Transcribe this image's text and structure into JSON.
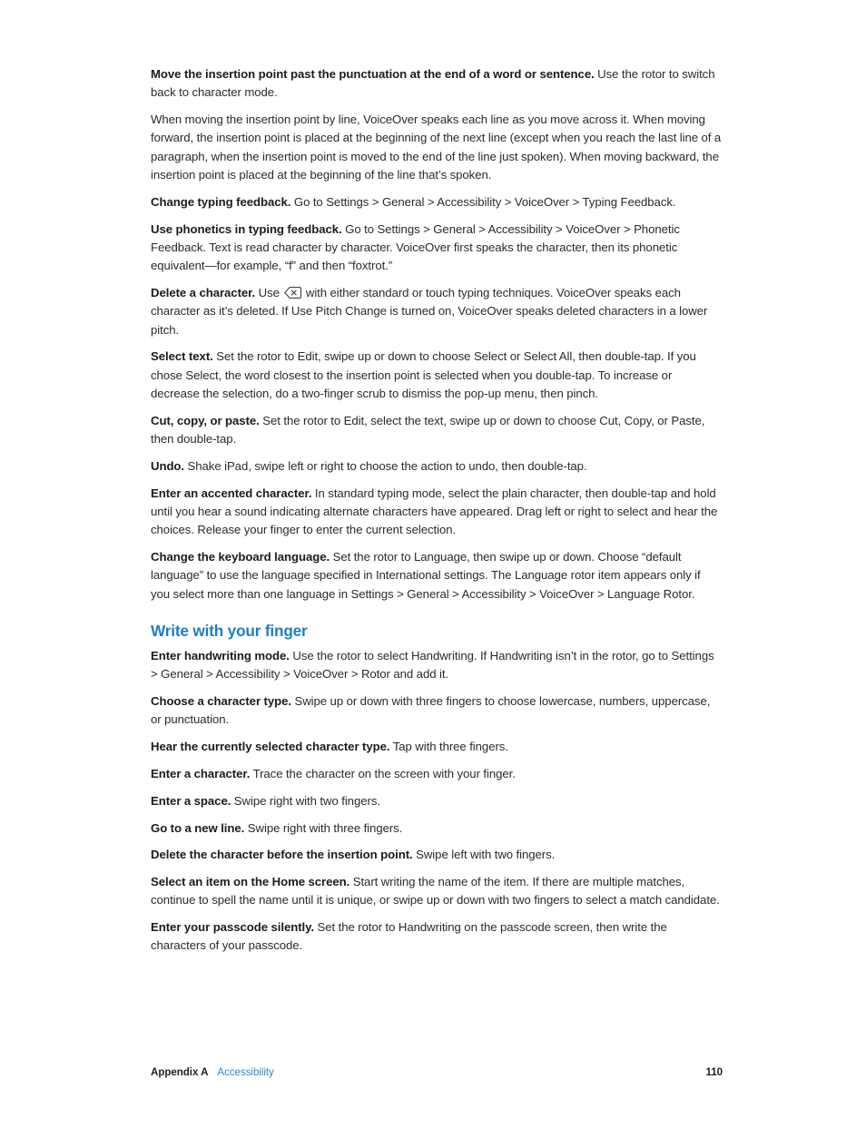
{
  "page": {
    "background_color": "#ffffff",
    "text_color": "#2c2a2b",
    "heading_color": "#1f7ec4",
    "link_color": "#2f86d8"
  },
  "body": {
    "paragraphs": [
      {
        "id": "move-insertion-point",
        "lead": "Move the insertion point past the punctuation at the end of a word or sentence.",
        "text": " Use the rotor to switch back to character mode."
      },
      {
        "id": "moving-by-line",
        "lead": "",
        "text": "When moving the insertion point by line, VoiceOver speaks each line as you move across it. When moving forward, the insertion point is placed at the beginning of the next line (except when you reach the last line of a paragraph, when the insertion point is moved to the end of the line just spoken). When moving backward, the insertion point is placed at the beginning of the line that’s spoken."
      },
      {
        "id": "change-typing-feedback",
        "lead": "Change typing feedback.",
        "text": " Go to Settings > General > Accessibility > VoiceOver > Typing Feedback."
      },
      {
        "id": "use-phonetics",
        "lead": "Use phonetics in typing feedback.",
        "text": " Go to Settings > General > Accessibility > VoiceOver > Phonetic Feedback. Text is read character by character. VoiceOver first speaks the character, then its phonetic equivalent—for example, “f” and then “foxtrot.”"
      },
      {
        "id": "delete-a-character",
        "lead": "Delete a character.",
        "text_before_icon": " Use ",
        "icon": "delete-key-icon",
        "text_after_icon": " with either standard or touch typing techniques. VoiceOver speaks each character as it’s deleted. If Use Pitch Change is turned on, VoiceOver speaks deleted characters in a lower pitch."
      },
      {
        "id": "select-text",
        "lead": "Select text.",
        "text": " Set the rotor to Edit, swipe up or down to choose Select or Select All, then double-tap. If you chose Select, the word closest to the insertion point is selected when you double-tap. To increase or decrease the selection, do a two-finger scrub to dismiss the pop-up menu, then pinch."
      },
      {
        "id": "cut-copy-paste",
        "lead": "Cut, copy, or paste.",
        "text": " Set the rotor to Edit, select the text, swipe up or down to choose Cut, Copy, or Paste, then double-tap."
      },
      {
        "id": "undo",
        "lead": "Undo.",
        "text": " Shake iPad, swipe left or right to choose the action to undo, then double-tap."
      },
      {
        "id": "enter-accented-character",
        "lead": "Enter an accented character.",
        "text": " In standard typing mode, select the plain character, then double-tap and hold until you hear a sound indicating alternate characters have appeared. Drag left or right to select and hear the choices. Release your finger to enter the current selection."
      },
      {
        "id": "change-keyboard-language",
        "lead": "Change the keyboard language.",
        "text": " Set the rotor to Language, then swipe up or down. Choose “default language” to use the language specified in International settings. The Language rotor item appears only if you select more than one language in Settings > General > Accessibility > VoiceOver > Language Rotor."
      }
    ],
    "section": {
      "heading": "Write with your finger",
      "paragraphs": [
        {
          "id": "enter-handwriting-mode",
          "lead": "Enter handwriting mode.",
          "text": " Use the rotor to select Handwriting. If Handwriting isn’t in the rotor, go to Settings > General > Accessibility > VoiceOver > Rotor and add it."
        },
        {
          "id": "choose-character-type",
          "lead": "Choose a character type.",
          "text": " Swipe up or down with three fingers to choose lowercase, numbers, uppercase, or punctuation."
        },
        {
          "id": "hear-selected-character-type",
          "lead": "Hear the currently selected character type.",
          "text": " Tap with three fingers."
        },
        {
          "id": "enter-a-character",
          "lead": "Enter a character.",
          "text": " Trace the character on the screen with your finger."
        },
        {
          "id": "enter-a-space",
          "lead": "Enter a space.",
          "text": " Swipe right with two fingers."
        },
        {
          "id": "go-to-new-line",
          "lead": "Go to a new line.",
          "text": " Swipe right with three fingers."
        },
        {
          "id": "delete-character-before-insertion-point",
          "lead": "Delete the character before the insertion point.",
          "text": " Swipe left with two fingers."
        },
        {
          "id": "select-item-home-screen",
          "lead": "Select an item on the Home screen.",
          "text": " Start writing the name of the item. If there are multiple matches, continue to spell the name until it is unique, or swipe up or down with two fingers to select a match candidate."
        },
        {
          "id": "enter-passcode-silently",
          "lead": "Enter your passcode silently.",
          "text": " Set the rotor to Handwriting on the passcode screen, then write the characters of your passcode."
        }
      ]
    }
  },
  "footer": {
    "appendix": "Appendix A",
    "chapter": "Accessibility",
    "page_number": "110"
  }
}
